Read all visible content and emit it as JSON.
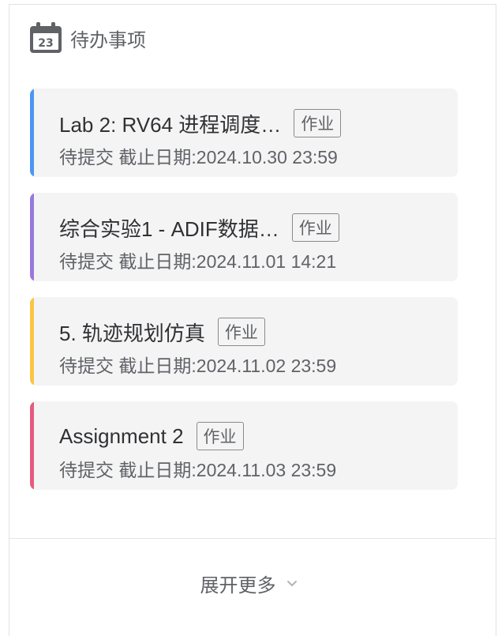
{
  "header": {
    "title": "待办事项",
    "calendar_day": "23",
    "icon": "calendar-icon"
  },
  "todos": [
    {
      "title": "Lab 2: RV64 进程调度…",
      "tag": "作业",
      "status_line": "待提交 截止日期:2024.10.30 23:59",
      "color": "#4b96f5"
    },
    {
      "title": "综合实验1 - ADIF数据…",
      "tag": "作业",
      "status_line": "待提交 截止日期:2024.11.01 14:21",
      "color": "#9878dc"
    },
    {
      "title": "5. 轨迹规划仿真",
      "tag": "作业",
      "status_line": "待提交 截止日期:2024.11.02 23:59",
      "color": "#fbc545"
    },
    {
      "title": "Assignment 2",
      "tag": "作业",
      "status_line": "待提交 截止日期:2024.11.03 23:59",
      "color": "#e55b7d"
    }
  ],
  "footer": {
    "expand_label": "展开更多",
    "icon": "chevron-down-icon"
  }
}
